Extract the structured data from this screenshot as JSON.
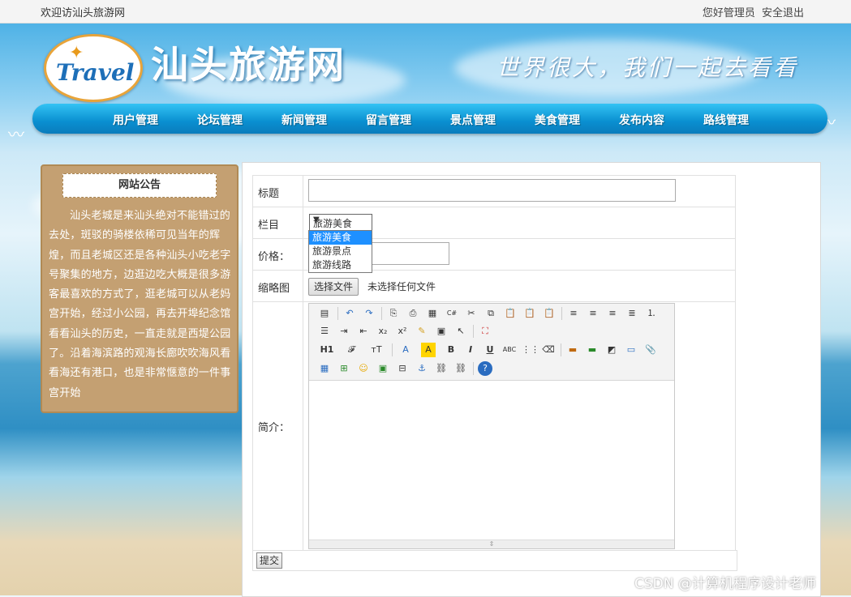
{
  "topbar": {
    "welcome": "欢迎访汕头旅游网",
    "greeting": "您好管理员",
    "logout": "安全退出"
  },
  "header": {
    "logo_text": "Travel",
    "site_title": "汕头旅游网",
    "slogan": "世界很大，我们一起去看看"
  },
  "nav": {
    "items": [
      {
        "label": "用户管理"
      },
      {
        "label": "论坛管理"
      },
      {
        "label": "新闻管理"
      },
      {
        "label": "留言管理"
      },
      {
        "label": "景点管理"
      },
      {
        "label": "美食管理"
      },
      {
        "label": "发布内容"
      },
      {
        "label": "路线管理"
      }
    ]
  },
  "notice": {
    "title": "网站公告",
    "body": "汕头老城是来汕头绝对不能错过的去处，斑驳的骑楼依稀可见当年的辉煌，而且老城区还是各种汕头小吃老字号聚集的地方，边逛边吃大概是很多游客最喜欢的方式了，逛老城可以从老妈宫开始，经过小公园，再去开埠纪念馆看看汕头的历史，一直走就是西堤公园了。沿着海滨路的观海长廊吹吹海风看看海还有港口，也是非常惬意的一件事宫开始"
  },
  "form": {
    "title_label": "标题",
    "title_value": "",
    "column_label": "栏目",
    "column_selected": "旅游美食",
    "column_options": [
      "旅游美食",
      "旅游景点",
      "旅游线路"
    ],
    "price_label": "价格：",
    "price_value": "",
    "thumb_label": "缩略图",
    "file_button": "选择文件",
    "file_status": "未选择任何文件",
    "intro_label": "简介：",
    "submit": "提交"
  },
  "editor": {
    "toolbar_labels": {
      "heading": "H1",
      "font": "𝓕",
      "size": "тT",
      "bold": "B",
      "italic": "I",
      "underline": "U",
      "strike": "ABC",
      "sub": "x₂",
      "sup": "x²"
    }
  },
  "watermark": "CSDN @计算机程序设计老师"
}
